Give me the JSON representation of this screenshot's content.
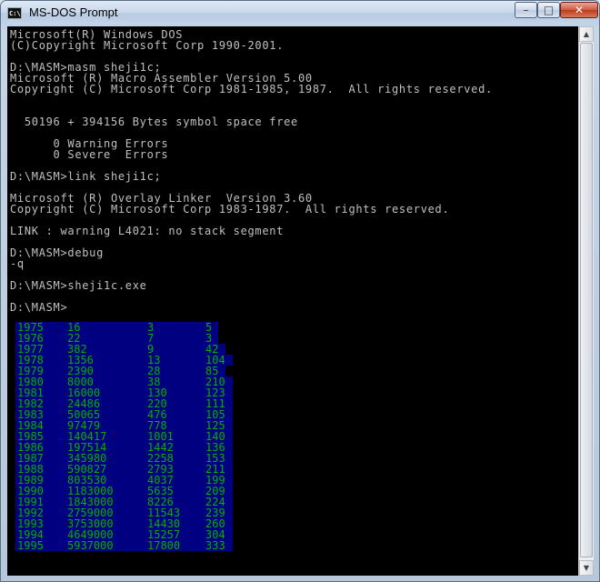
{
  "window": {
    "title": "MS-DOS Prompt",
    "icon_text": "C:\\"
  },
  "controls": {
    "minimize": "–",
    "maximize": "□",
    "close": "✕"
  },
  "console_lines": [
    "Microsoft(R) Windows DOS",
    "(C)Copyright Microsoft Corp 1990-2001.",
    "",
    "D:\\MASM>masm sheji1c;",
    "Microsoft (R) Macro Assembler Version 5.00",
    "Copyright (C) Microsoft Corp 1981-1985, 1987.  All rights reserved.",
    "",
    "",
    "  50196 + 394156 Bytes symbol space free",
    "",
    "      0 Warning Errors",
    "      0 Severe  Errors",
    "",
    "D:\\MASM>link sheji1c;",
    "",
    "Microsoft (R) Overlay Linker  Version 3.60",
    "Copyright (C) Microsoft Corp 1983-1987.  All rights reserved.",
    "",
    "LINK : warning L4021: no stack segment",
    "",
    "D:\\MASM>debug",
    "-q",
    "",
    "D:\\MASM>sheji1c.exe",
    "",
    "D:\\MASM>"
  ],
  "table_rows": [
    [
      "1975",
      "16",
      "3",
      "5"
    ],
    [
      "1976",
      "22",
      "7",
      "3"
    ],
    [
      "1977",
      "382",
      "9",
      "42"
    ],
    [
      "1978",
      "1356",
      "13",
      "104"
    ],
    [
      "1979",
      "2390",
      "28",
      "85"
    ],
    [
      "1980",
      "8000",
      "38",
      "210"
    ],
    [
      "1981",
      "16000",
      "130",
      "123"
    ],
    [
      "1982",
      "24486",
      "220",
      "111"
    ],
    [
      "1983",
      "50065",
      "476",
      "105"
    ],
    [
      "1984",
      "97479",
      "778",
      "125"
    ],
    [
      "1985",
      "140417",
      "1001",
      "140"
    ],
    [
      "1986",
      "197514",
      "1442",
      "136"
    ],
    [
      "1987",
      "345980",
      "2258",
      "153"
    ],
    [
      "1988",
      "590827",
      "2793",
      "211"
    ],
    [
      "1989",
      "803530",
      "4037",
      "199"
    ],
    [
      "1990",
      "1183000",
      "5635",
      "209"
    ],
    [
      "1991",
      "1843000",
      "8226",
      "224"
    ],
    [
      "1992",
      "2759000",
      "11543",
      "239"
    ],
    [
      "1993",
      "3753000",
      "14430",
      "260"
    ],
    [
      "1994",
      "4649000",
      "15257",
      "304"
    ],
    [
      "1995",
      "5937000",
      "17800",
      "333"
    ]
  ],
  "colors": {
    "console_bg": "#000000",
    "console_text": "#c0c0c0",
    "table_bg": "#000080",
    "table_text": "#00b000"
  },
  "icons": {
    "app": "msdos-app-icon",
    "scroll_up": "scroll-up-arrow-icon",
    "scroll_down": "scroll-down-arrow-icon"
  }
}
